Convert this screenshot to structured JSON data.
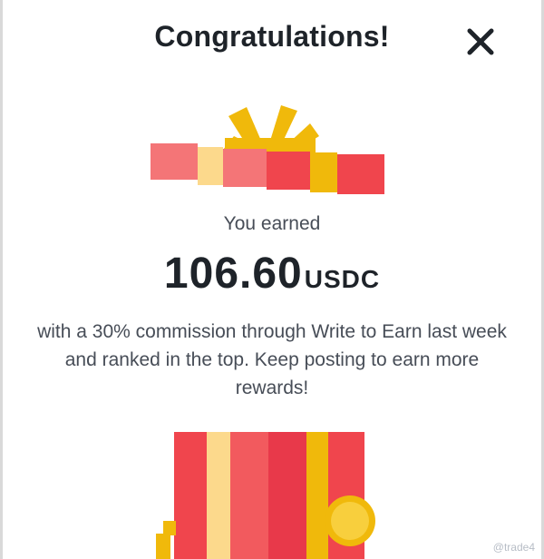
{
  "modal": {
    "title": "Congratulations!",
    "close_icon": "close-icon",
    "earned_label": "You earned",
    "amount": "106.60",
    "currency": "USDC",
    "description": "with a 30% commission through Write to Earn last week and ranked in the top. Keep posting to earn more rewards!"
  },
  "watermark": "@trade4",
  "colors": {
    "text_primary": "#1e2329",
    "text_secondary": "#474d57",
    "gift_red": "#f0454d",
    "gift_pink": "#f47577",
    "gift_gold": "#f0b90b",
    "gift_cream": "#fcd98c"
  }
}
